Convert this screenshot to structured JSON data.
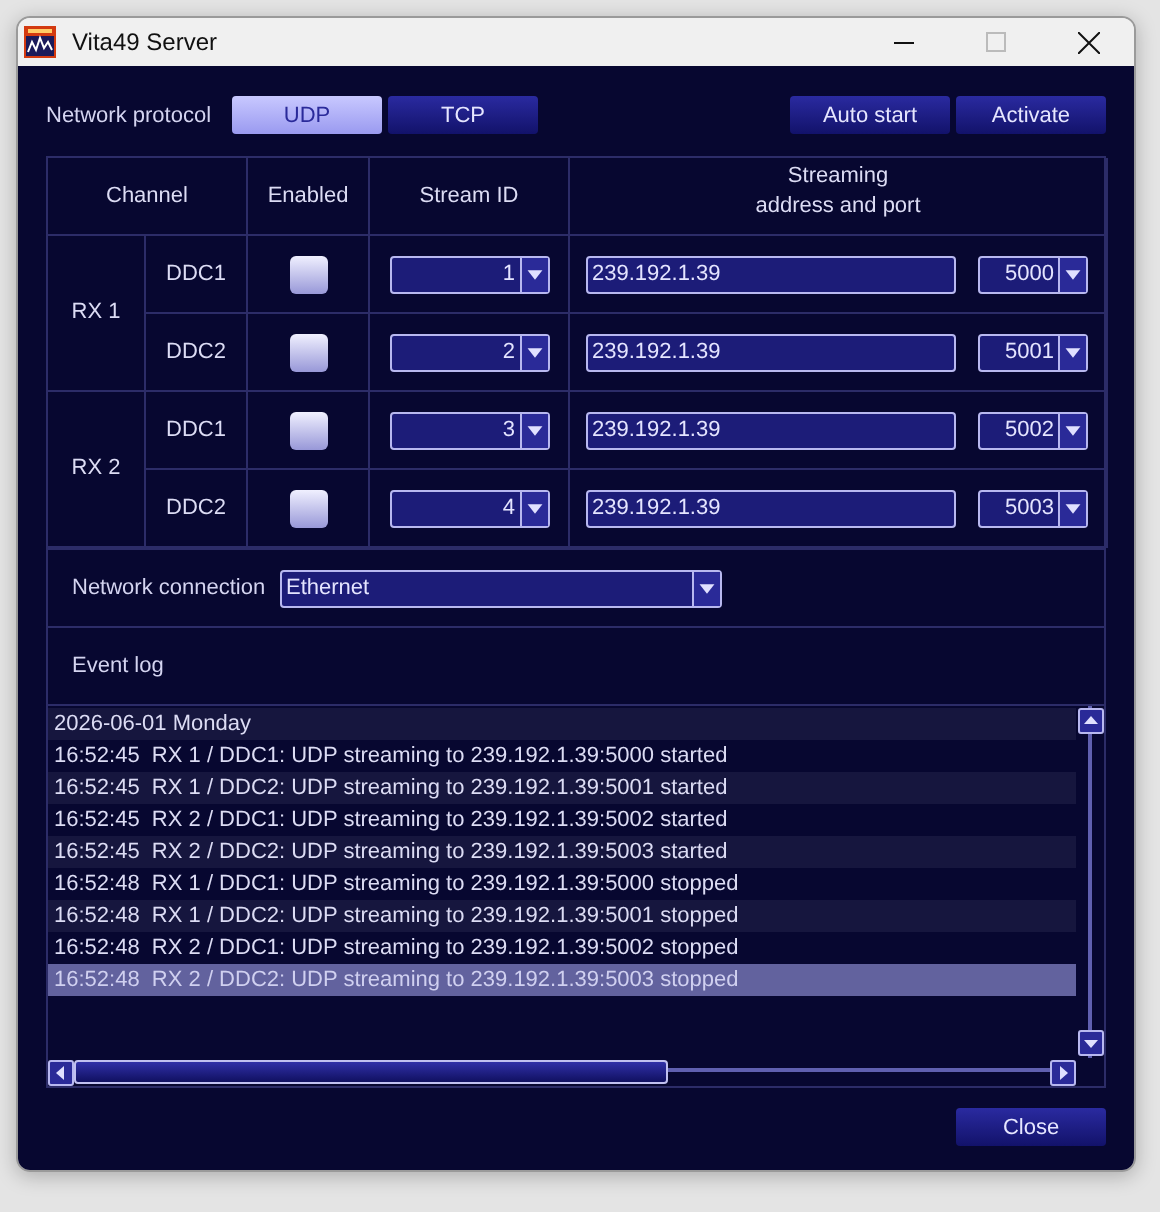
{
  "window": {
    "title": "Vita49 Server"
  },
  "protocol": {
    "label": "Network protocol",
    "options": [
      {
        "label": "UDP",
        "selected": true
      },
      {
        "label": "TCP",
        "selected": false
      }
    ]
  },
  "actions": [
    "Auto start",
    "Activate"
  ],
  "table": {
    "columns": [
      "Channel",
      "Enabled",
      "Stream ID",
      "Streaming\naddress and port"
    ],
    "groups": [
      {
        "name": "RX 1",
        "channels": [
          {
            "name": "DDC1",
            "enabled": false,
            "stream_id": "1",
            "address": "239.192.1.39",
            "port": "5000"
          },
          {
            "name": "DDC2",
            "enabled": false,
            "stream_id": "2",
            "address": "239.192.1.39",
            "port": "5001"
          }
        ]
      },
      {
        "name": "RX 2",
        "channels": [
          {
            "name": "DDC1",
            "enabled": false,
            "stream_id": "3",
            "address": "239.192.1.39",
            "port": "5002"
          },
          {
            "name": "DDC2",
            "enabled": false,
            "stream_id": "4",
            "address": "239.192.1.39",
            "port": "5003"
          }
        ]
      }
    ]
  },
  "network_connection": {
    "label": "Network connection",
    "value": "Ethernet"
  },
  "event_log": {
    "label": "Event log",
    "entries": [
      {
        "text": "2026-06-01 Monday",
        "selected": false
      },
      {
        "text": "16:52:45  RX 1 / DDC1: UDP streaming to 239.192.1.39:5000 started",
        "selected": false
      },
      {
        "text": "16:52:45  RX 1 / DDC2: UDP streaming to 239.192.1.39:5001 started",
        "selected": false
      },
      {
        "text": "16:52:45  RX 2 / DDC1: UDP streaming to 239.192.1.39:5002 started",
        "selected": false
      },
      {
        "text": "16:52:45  RX 2 / DDC2: UDP streaming to 239.192.1.39:5003 started",
        "selected": false
      },
      {
        "text": "16:52:48  RX 1 / DDC1: UDP streaming to 239.192.1.39:5000 stopped",
        "selected": false
      },
      {
        "text": "16:52:48  RX 1 / DDC2: UDP streaming to 239.192.1.39:5001 stopped",
        "selected": false
      },
      {
        "text": "16:52:48  RX 2 / DDC1: UDP streaming to 239.192.1.39:5002 stopped",
        "selected": false
      },
      {
        "text": "16:52:48  RX 2 / DDC2: UDP streaming to 239.192.1.39:5003 stopped",
        "selected": true
      }
    ]
  },
  "close_button": "Close"
}
